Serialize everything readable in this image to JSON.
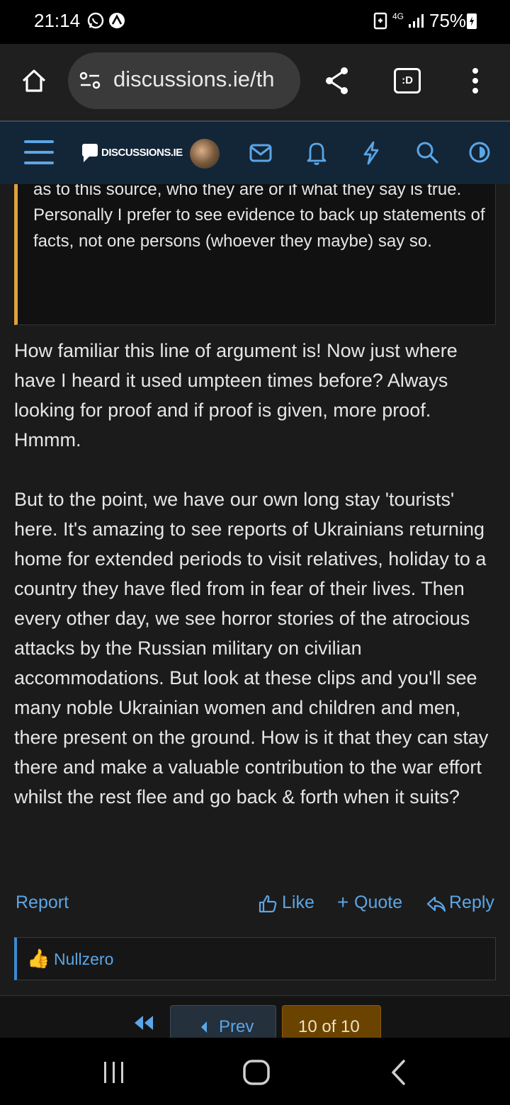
{
  "status_bar": {
    "time": "21:14",
    "battery": "75%",
    "network": "4G",
    "icons": [
      "whatsapp-icon",
      "sync-icon",
      "battery-saver-icon",
      "signal-icon",
      "battery-icon"
    ]
  },
  "browser": {
    "url": "discussions.ie/th",
    "icons": [
      "home-icon",
      "site-settings-icon",
      "share-icon",
      "tab-switcher-icon",
      "menu-icon"
    ],
    "tab_label": ":D"
  },
  "site_header": {
    "logo_text": "DISCUSSIONS.IE",
    "icons": [
      "hamburger-menu-icon",
      "logo-icon",
      "avatar",
      "inbox-icon",
      "bell-icon",
      "lightning-icon",
      "search-icon",
      "theme-toggle-icon"
    ]
  },
  "post": {
    "quote_lines": "as to this source, who they are or if what they say is true.\nPersonally I prefer to see evidence to back up statements of facts, not one persons (whoever they maybe) say so.",
    "body": "How familiar this line of argument is! Now just where have I heard it used umpteen times before? Always looking for proof and if proof is given, more proof. Hmmm.\n\nBut to the point, we have our own long stay 'tourists' here. It's amazing to see reports of Ukrainians returning home for extended periods to visit relatives, holiday to a country they have fled from in fear of their lives. Then every other day, we see horror stories of the atrocious attacks by the Russian military on civilian accommodations. But look at these clips and you'll see many noble Ukrainian women and children and men, there present on the ground. How is it that they can stay there and make a valuable contribution to the war effort whilst the rest flee and go back & forth when it suits?",
    "actions": {
      "report": "Report",
      "like": "Like",
      "quote": "Quote",
      "reply": "Reply"
    },
    "reaction": {
      "emoji": "👍",
      "user": "Nullzero"
    }
  },
  "pagination": {
    "prev": "Prev",
    "current": "10 of 10"
  },
  "colors": {
    "accent": "#5ba6e6",
    "header_bg": "#132637",
    "quote_border": "#e0a23a",
    "page_current_bg": "#6b4300"
  }
}
